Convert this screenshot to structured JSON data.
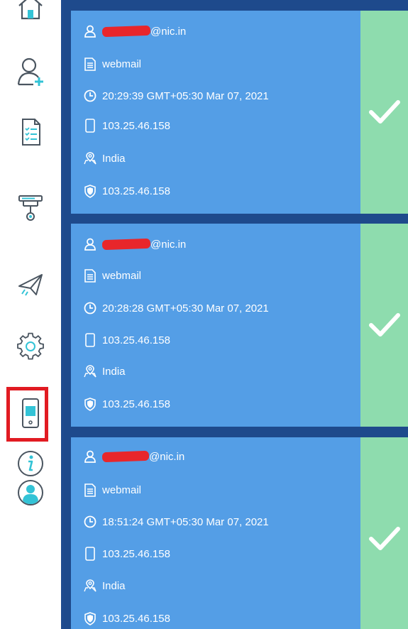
{
  "sidebar": {
    "items": [
      {
        "name": "home"
      },
      {
        "name": "add-user"
      },
      {
        "name": "reports"
      },
      {
        "name": "router"
      },
      {
        "name": "send"
      },
      {
        "name": "settings"
      },
      {
        "name": "devices"
      },
      {
        "name": "info"
      },
      {
        "name": "profile"
      }
    ],
    "highlight_color": "#e11b22"
  },
  "sessions": [
    {
      "email_suffix": "@nic.in",
      "app": "webmail",
      "time": "20:29:39 GMT+05:30 Mar 07, 2021",
      "device_ip": "103.25.46.158",
      "location": "India",
      "public_ip": "103.25.46.158",
      "status": "approved"
    },
    {
      "email_suffix": "@nic.in",
      "app": "webmail",
      "time": "20:28:28 GMT+05:30 Mar 07, 2021",
      "device_ip": "103.25.46.158",
      "location": "India",
      "public_ip": "103.25.46.158",
      "status": "approved"
    },
    {
      "email_suffix": "@nic.in",
      "app": "webmail",
      "time": "18:51:24 GMT+05:30 Mar 07, 2021",
      "device_ip": "103.25.46.158",
      "location": "India",
      "public_ip": "103.25.46.158",
      "status": "approved"
    }
  ],
  "colors": {
    "card_bg": "#549ee6",
    "status_bg": "#8edcae",
    "main_bg": "#1e4a8c"
  }
}
